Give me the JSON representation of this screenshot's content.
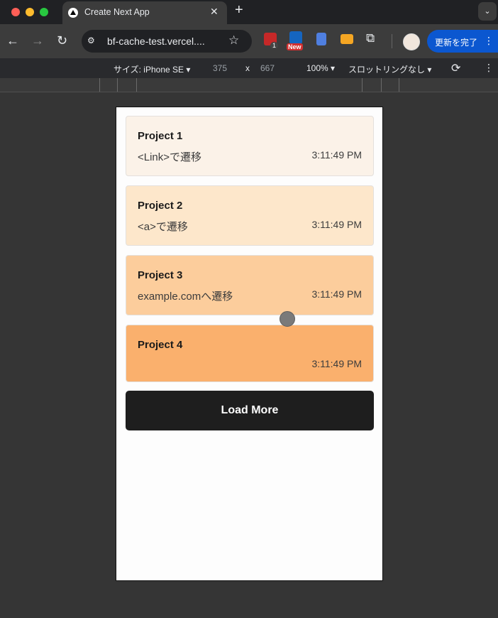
{
  "browser": {
    "tab_title": "Create Next App",
    "tab_close": "✕",
    "new_tab": "+",
    "tab_search": "⌄",
    "nav": {
      "back": "←",
      "forward": "→",
      "reload": "↻"
    },
    "url": "bf-cache-test.vercel....",
    "bookmark": "☆",
    "extensions": {
      "ext1_badge": "1",
      "ext2_badge": "New",
      "puzzle": "⧉"
    },
    "update_button": "更新を完了",
    "menu": "⋮"
  },
  "device_toolbar": {
    "size": "サイズ: iPhone SE ▾",
    "width": "375",
    "times": "x",
    "height": "667",
    "zoom": "100% ▾",
    "throttle": "スロットリングなし ▾",
    "rotate": "⟳",
    "more": "⋮"
  },
  "cards": [
    {
      "title": "Project 1",
      "desc": "<Link>で遷移",
      "time": "3:11:49 PM",
      "bg": "#fbf2e8"
    },
    {
      "title": "Project 2",
      "desc": "<a>で遷移",
      "time": "3:11:49 PM",
      "bg": "#fde7cb"
    },
    {
      "title": "Project 3",
      "desc": "example.comへ遷移",
      "time": "3:11:49 PM",
      "bg": "#fccd9c"
    },
    {
      "title": "Project 4",
      "desc": "",
      "time": "3:11:49 PM",
      "bg": "#fab06d"
    }
  ],
  "load_more": "Load More"
}
